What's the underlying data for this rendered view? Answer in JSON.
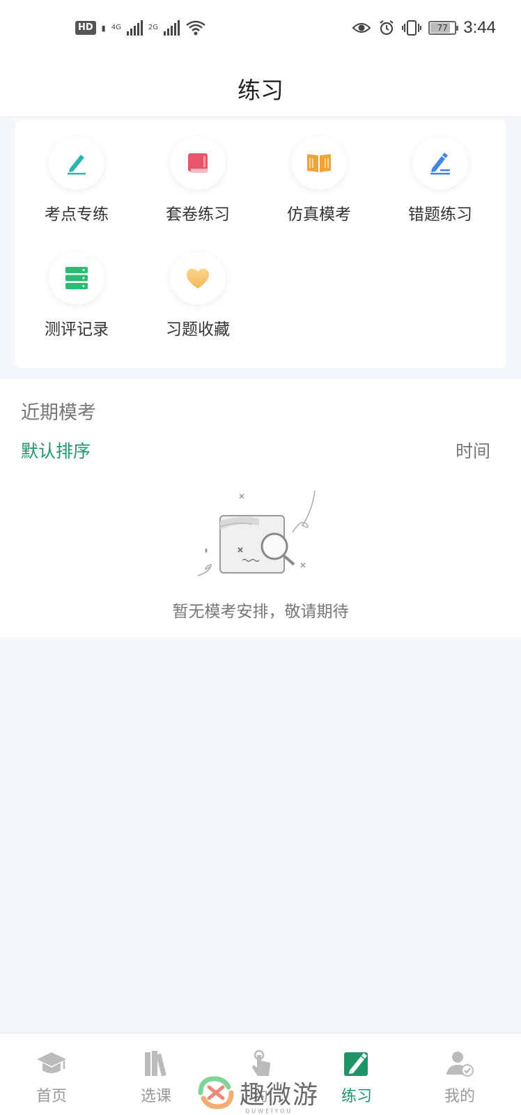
{
  "status_bar": {
    "hd_badge": "HD",
    "sim1_label": "4G",
    "sim2_label": "2G",
    "battery_level": "77",
    "time": "3:44"
  },
  "header": {
    "title": "练习"
  },
  "grid": {
    "items": [
      {
        "label": "考点专练",
        "icon": "pen-icon",
        "color": "#2cb6b0"
      },
      {
        "label": "套卷练习",
        "icon": "book-icon",
        "color": "#e8546a"
      },
      {
        "label": "仿真模考",
        "icon": "open-book-icon",
        "color": "#efa43a"
      },
      {
        "label": "错题练习",
        "icon": "edit-icon",
        "color": "#3f86e6"
      },
      {
        "label": "测评记录",
        "icon": "server-stack-icon",
        "color": "#2dba73"
      },
      {
        "label": "习题收藏",
        "icon": "heart-icon",
        "color": "#f6c06a"
      }
    ]
  },
  "recent": {
    "title": "近期模考",
    "sort_default": "默认排序",
    "sort_time": "时间",
    "empty_text": "暂无模考安排，敬请期待"
  },
  "tabbar": {
    "items": [
      {
        "label": "首页",
        "icon": "graduation-cap-icon",
        "active": false
      },
      {
        "label": "选课",
        "icon": "books-icon",
        "active": false
      },
      {
        "label": "约",
        "icon": "tap-hand-icon",
        "active": false
      },
      {
        "label": "练习",
        "icon": "practice-edit-icon",
        "active": true
      },
      {
        "label": "我的",
        "icon": "user-check-icon",
        "active": false
      }
    ]
  },
  "watermark": {
    "text": "趣微游",
    "sub": "QUWEIYOU"
  },
  "colors": {
    "accent": "#1e9569",
    "background": "#f5f7fa"
  }
}
